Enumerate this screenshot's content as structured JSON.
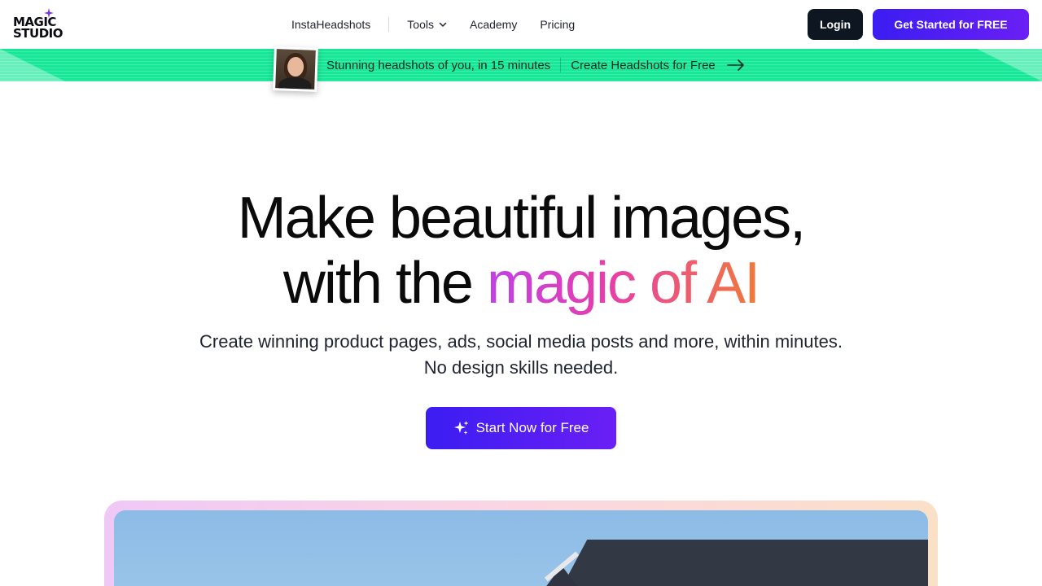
{
  "header": {
    "logo": {
      "line1": "MAGIC",
      "line2": "STUDIO"
    },
    "nav": [
      {
        "label": "InstaHeadshots"
      },
      {
        "label": "Tools"
      },
      {
        "label": "Academy"
      },
      {
        "label": "Pricing"
      }
    ],
    "login_label": "Login",
    "get_started_label": "Get Started for FREE"
  },
  "banner": {
    "text": "Stunning headshots of you, in 15 minutes",
    "cta": "Create Headshots for Free"
  },
  "hero": {
    "title_line1": "Make beautiful images,",
    "title_line2_plain": "with the ",
    "title_line2_gradient": "magic of AI",
    "subtitle_line1": "Create winning product pages, ads, social media posts and more, within minutes.",
    "subtitle_line2": "No design skills needed.",
    "cta_label": "Start Now for Free"
  },
  "colors": {
    "accent": "#4a1ff4",
    "banner_green": "#17e898",
    "dark_button": "#0e1622"
  }
}
